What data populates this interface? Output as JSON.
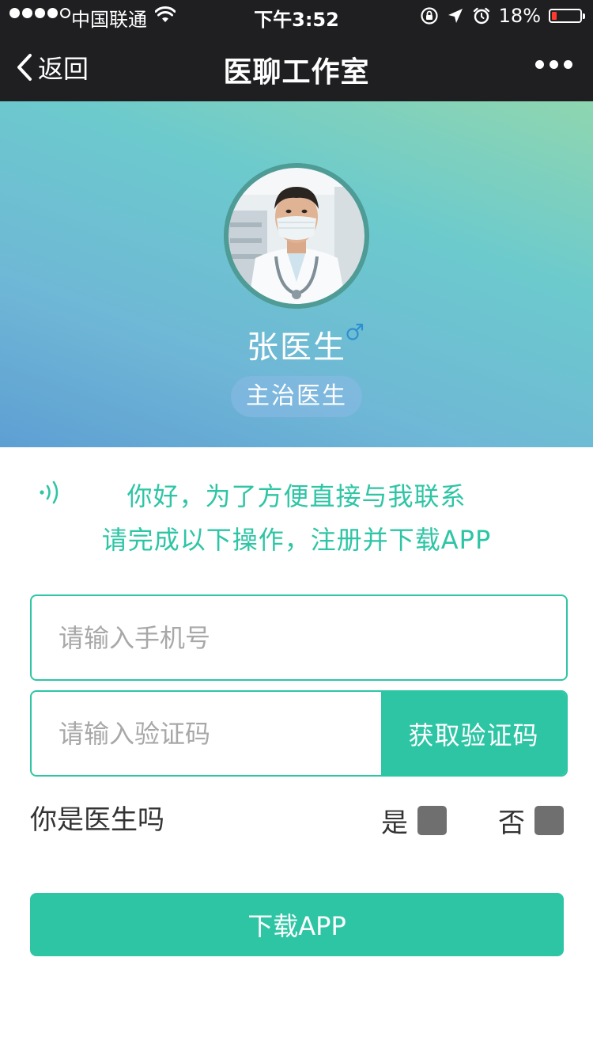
{
  "status_bar": {
    "carrier": "中国联通",
    "time": "下午3:52",
    "battery_percent": "18%",
    "battery_level": 0.18,
    "signal_bars_filled": 4,
    "signal_bars_total": 5,
    "icons": [
      "wifi-icon",
      "rotation-lock-icon",
      "location-arrow-icon",
      "alarm-icon",
      "battery-icon"
    ]
  },
  "nav": {
    "back_label": "返回",
    "title": "医聊工作室",
    "more_icon": "ellipsis-icon"
  },
  "profile": {
    "name": "张医生",
    "gender_symbol": "♂",
    "title": "主治医生",
    "avatar_icon": "doctor-avatar"
  },
  "greeting": {
    "line1": "你好，为了方便直接与我联系",
    "line2": "请完成以下操作，注册并下载APP",
    "icon": "sound-wave-icon"
  },
  "form": {
    "phone_placeholder": "请输入手机号",
    "code_placeholder": "请输入验证码",
    "get_code_label": "获取验证码",
    "doctor_question": "你是医生吗",
    "yes_label": "是",
    "no_label": "否",
    "download_label": "下载APP"
  },
  "colors": {
    "accent": "#2ec5a5",
    "nav_background": "#1f1f22",
    "checkbox": "#6f6f6f",
    "battery_low": "#ff3b30"
  }
}
